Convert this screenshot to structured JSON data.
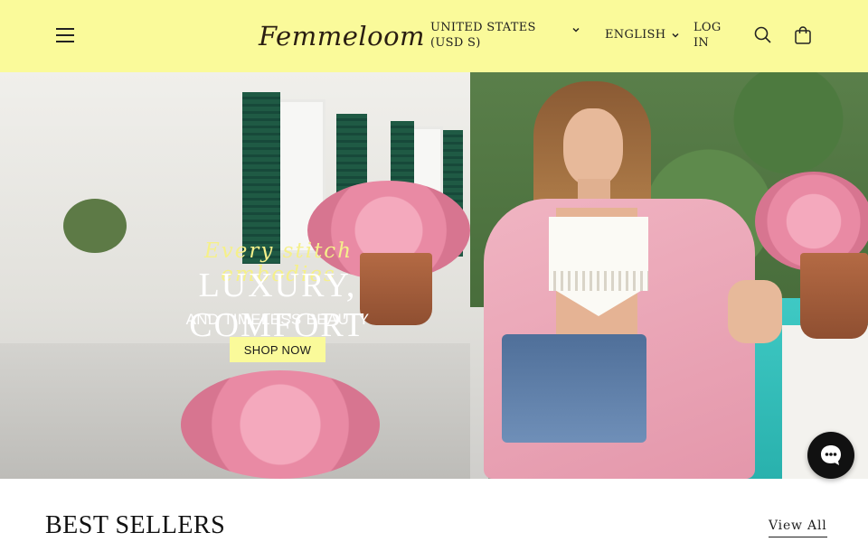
{
  "header": {
    "brand": "Femmeloom",
    "country_select": "UNITED STATES (USD S)",
    "language_select": "ENGLISH",
    "login": "LOG IN",
    "background": "#fafa9a"
  },
  "icons": {
    "menu": "hamburger-menu-icon",
    "search": "search-icon",
    "cart": "shopping-bag-icon",
    "chat": "chat-bubble-icon"
  },
  "hero": {
    "script_line": "Every stitch embodies",
    "title": "LUXURY, COMFORT",
    "subtitle": "AND TIMELESS BEAUTY",
    "cta": "SHOP NOW"
  },
  "best_sellers": {
    "title": "BEST SELLERS",
    "link": "View All"
  }
}
